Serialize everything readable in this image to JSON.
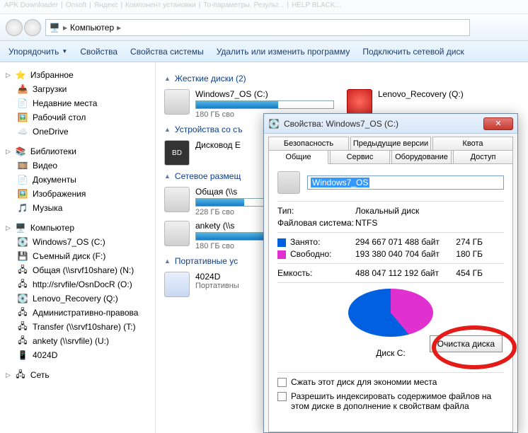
{
  "tabs_top": [
    "APK Downloader",
    "Onsoft",
    "Яндекс",
    "Компонент установки",
    "То-параметры. Результ...",
    "HELP BLACK..."
  ],
  "breadcrumb": {
    "root_icon": "computer-icon",
    "label": "Компьютер"
  },
  "toolbar": {
    "organize": "Упорядочить",
    "properties": "Свойства",
    "sys_properties": "Свойства системы",
    "uninstall": "Удалить или изменить программу",
    "map_drive": "Подключить сетевой диск"
  },
  "sidebar": {
    "favorites": {
      "label": "Избранное",
      "items": [
        "Загрузки",
        "Недавние места",
        "Рабочий стол",
        "OneDrive"
      ]
    },
    "libraries": {
      "label": "Библиотеки",
      "items": [
        "Видео",
        "Документы",
        "Изображения",
        "Музыка"
      ]
    },
    "computer": {
      "label": "Компьютер",
      "items": [
        "Windows7_OS (C:)",
        "Съемный диск (F:)",
        "Общая (\\\\srvf10share) (N:)",
        "http://srvfile/OsnDocR (O:)",
        "Lenovo_Recovery (Q:)",
        "Административно-правова",
        "Transfer (\\\\srvf10share) (T:)",
        "ankety (\\\\srvfile) (U:)",
        "4024D"
      ]
    },
    "network": {
      "label": "Сеть"
    }
  },
  "content": {
    "hdd_header": "Жесткие диски (2)",
    "hdd": [
      {
        "name": "Windows7_OS (C:)",
        "sub": "180 ГБ сво"
      },
      {
        "name": "Lenovo_Recovery (Q:)",
        "sub": ""
      }
    ],
    "removable_header": "Устройства со съ",
    "removable": [
      {
        "name": "Дисковод E",
        "sub": ""
      }
    ],
    "network_header": "Сетевое размещ",
    "network": [
      {
        "name": "Общая (\\\\s",
        "sub": "228 ГБ сво"
      },
      {
        "name": "ankety (\\\\s",
        "sub": "180 ГБ сво"
      }
    ],
    "portable_header": "Портативные ус",
    "portable": [
      {
        "name": "4024D",
        "sub": "Портативны"
      }
    ]
  },
  "dialog": {
    "title": "Свойства: Windows7_OS (C:)",
    "tabs_row1": [
      "Безопасность",
      "Предыдущие версии",
      "Квота"
    ],
    "tabs_row2": [
      "Общие",
      "Сервис",
      "Оборудование",
      "Доступ"
    ],
    "active_tab": "Общие",
    "volume_name": "Windows7_OS",
    "type_label": "Тип:",
    "type_value": "Локальный диск",
    "fs_label": "Файловая система:",
    "fs_value": "NTFS",
    "used_label": "Занято:",
    "used_bytes": "294 667 071 488 байт",
    "used_gb": "274 ГБ",
    "free_label": "Свободно:",
    "free_bytes": "193 380 040 704 байт",
    "free_gb": "180 ГБ",
    "cap_label": "Емкость:",
    "cap_bytes": "488 047 112 192 байт",
    "cap_gb": "454 ГБ",
    "disk_label": "Диск C:",
    "cleanup_btn": "Очистка диска",
    "compress": "Сжать этот диск для экономии места",
    "index": "Разрешить индексировать содержимое файлов на этом диске в дополнение к свойствам файла"
  },
  "chart_data": {
    "type": "pie",
    "title": "Диск C:",
    "series": [
      {
        "name": "Занято",
        "value": 294667071488,
        "color": "#0060e0"
      },
      {
        "name": "Свободно",
        "value": 193380040704,
        "color": "#e030d0"
      }
    ]
  }
}
